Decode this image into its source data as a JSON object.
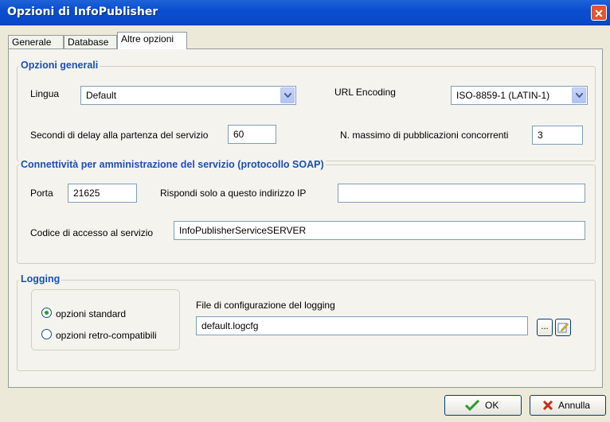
{
  "window": {
    "title": "Opzioni di InfoPublisher",
    "close_glyph": "✕"
  },
  "tabs": [
    {
      "label": "Generale"
    },
    {
      "label": "Database"
    },
    {
      "label": "Altre opzioni",
      "selected": true
    }
  ],
  "general": {
    "title": "Opzioni generali",
    "lingua_label": "Lingua",
    "lingua_value": "Default",
    "url_encoding_label": "URL Encoding",
    "url_encoding_value": "ISO-8859-1 (LATIN-1)",
    "delay_label": "Secondi di delay alla partenza del servizio",
    "delay_value": "60",
    "max_pub_label": "N. massimo di pubblicazioni concorrenti",
    "max_pub_value": "3"
  },
  "soap": {
    "title": "Connettività per amministrazione del servizio (protocollo SOAP)",
    "porta_label": "Porta",
    "porta_value": "21625",
    "ip_label": "Rispondi solo a questo indirizzo IP",
    "ip_value": "",
    "code_label": "Codice di accesso al servizio",
    "code_value": "InfoPublisherServiceSERVER"
  },
  "logging": {
    "title": "Logging",
    "option_standard": "opzioni standard",
    "option_retro": "opzioni retro-compatibili",
    "selected_option": "opzioni standard",
    "file_label": "File di configurazione del logging",
    "file_value": "default.logcfg",
    "browse_label": "..."
  },
  "buttons": {
    "ok": "OK",
    "cancel": "Annulla"
  },
  "colors": {
    "titlebar": "#0a4fd0",
    "group_title": "#1b4fb8",
    "radio_dot": "#21a121",
    "ok_check": "#2d9b2d",
    "cancel_x": "#cc2a1a"
  }
}
